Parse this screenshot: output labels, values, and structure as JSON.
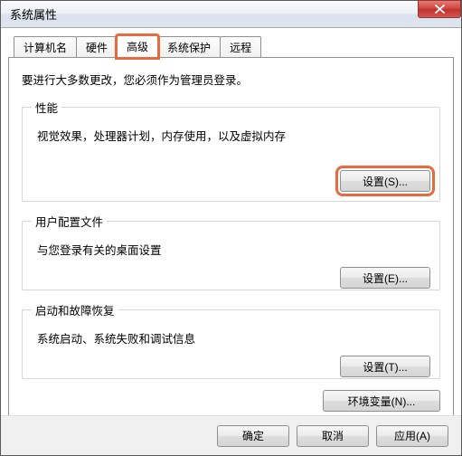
{
  "window": {
    "title": "系统属性"
  },
  "tabs": {
    "computer_name": "计算机名",
    "hardware": "硬件",
    "advanced": "高级",
    "system_protection": "系统保护",
    "remote": "远程"
  },
  "intro": "要进行大多数更改，您必须作为管理员登录。",
  "performance": {
    "legend": "性能",
    "desc": "视觉效果，处理器计划，内存使用，以及虚拟内存",
    "button": "设置(S)..."
  },
  "profiles": {
    "legend": "用户配置文件",
    "desc": "与您登录有关的桌面设置",
    "button": "设置(E)..."
  },
  "startup": {
    "legend": "启动和故障恢复",
    "desc": "系统启动、系统失败和调试信息",
    "button": "设置(T)..."
  },
  "env_button": "环境变量(N)...",
  "footer": {
    "ok": "确定",
    "cancel": "取消",
    "apply": "应用(A)"
  }
}
